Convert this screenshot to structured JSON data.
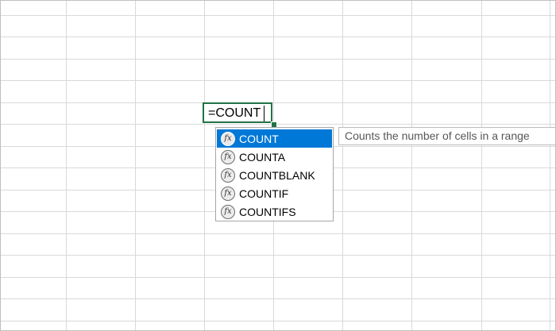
{
  "editor": {
    "formula": "=COUNT"
  },
  "autocomplete": {
    "items": [
      {
        "label": "COUNT",
        "icon": "function-icon",
        "selected": true
      },
      {
        "label": "COUNTA",
        "icon": "function-icon",
        "selected": false
      },
      {
        "label": "COUNTBLANK",
        "icon": "function-icon",
        "selected": false
      },
      {
        "label": "COUNTIF",
        "icon": "function-icon",
        "selected": false
      },
      {
        "label": "COUNTIFS",
        "icon": "function-icon",
        "selected": false
      }
    ]
  },
  "tooltip": {
    "text": "Counts the number of cells in a range"
  },
  "colors": {
    "accent": "#217346",
    "selection": "#0078d7",
    "gridline": "#d9d9d9"
  }
}
